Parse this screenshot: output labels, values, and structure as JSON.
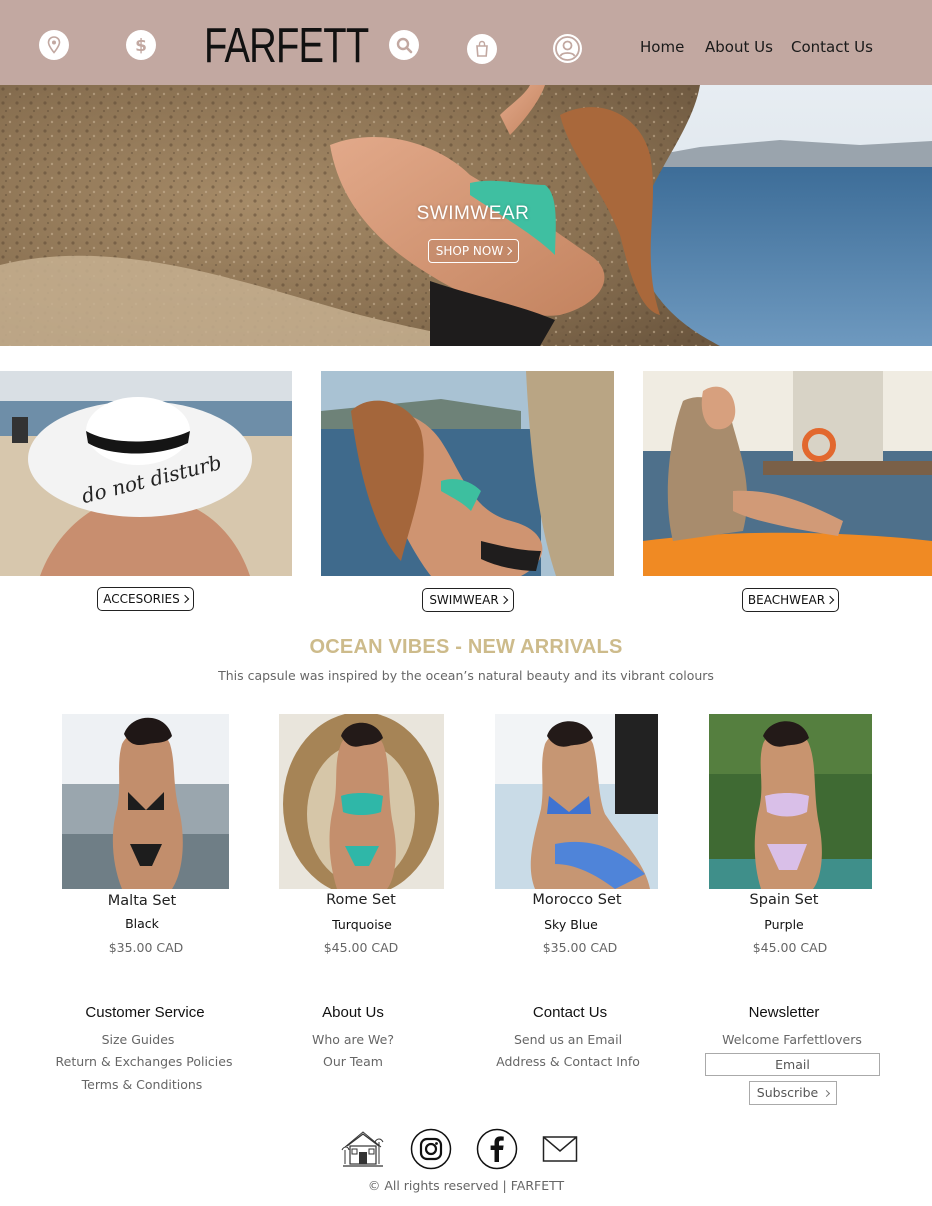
{
  "header": {
    "logo": "FARFETT",
    "icons": [
      "location-pin-icon",
      "dollar-icon",
      "search-icon",
      "shopping-bag-icon",
      "user-icon"
    ],
    "nav": [
      "Home",
      "About Us",
      "Contact Us"
    ]
  },
  "hero": {
    "title": "SWIMWEAR",
    "button": "SHOP NOW"
  },
  "categories": [
    "ACCESORIES",
    "SWIMWEAR",
    "BEACHWEAR"
  ],
  "arrivals": {
    "title": "OCEAN VIBES - NEW ARRIVALS",
    "subtitle": "This capsule was inspired by the ocean’s natural beauty and its vibrant colours"
  },
  "products": [
    {
      "name": "Malta Set",
      "color": "Black",
      "price": "$35.00 CAD"
    },
    {
      "name": "Rome Set",
      "color": "Turquoise",
      "price": "$45.00 CAD"
    },
    {
      "name": "Morocco Set",
      "color": "Sky Blue",
      "price": "$35.00 CAD"
    },
    {
      "name": "Spain Set",
      "color": "Purple",
      "price": "$45.00 CAD"
    }
  ],
  "footer": {
    "customer_service": {
      "title": "Customer Service",
      "links": [
        "Size Guides",
        "Return & Exchanges Policies",
        "Terms & Conditions"
      ]
    },
    "about": {
      "title": "About Us",
      "links": [
        "Who are We?",
        "Our Team"
      ]
    },
    "contact": {
      "title": "Contact Us",
      "links": [
        "Send us an Email",
        "Address & Contact Info"
      ]
    },
    "newsletter": {
      "title": "Newsletter",
      "text": "Welcome Farfettlovers",
      "email_placeholder": "Email",
      "button": "Subscribe"
    },
    "social_icons": [
      "beach-house-icon",
      "instagram-icon",
      "facebook-icon",
      "mail-icon"
    ],
    "copyright": "© All rights reserved | FARFETT"
  },
  "colors": {
    "header_bg": "#c2a8a1",
    "accent_gold": "#cdbb8b"
  }
}
